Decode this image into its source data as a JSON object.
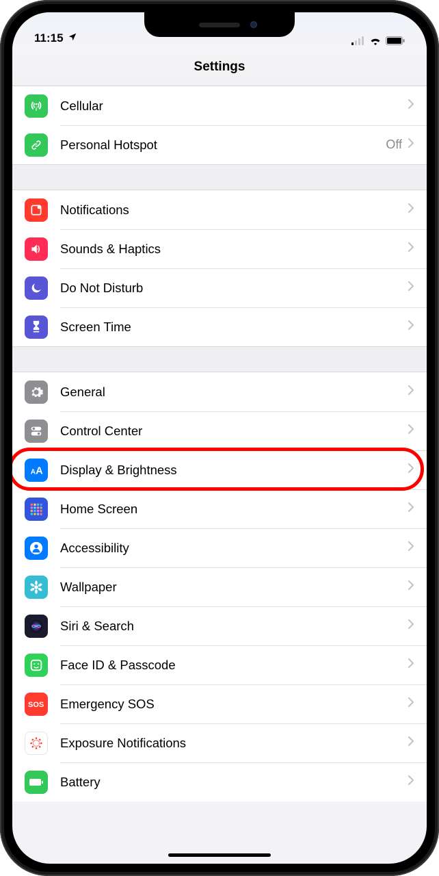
{
  "status": {
    "time": "11:15",
    "location_icon": "location-arrow",
    "signal_bars": 1,
    "wifi": true,
    "battery_full": true
  },
  "header": {
    "title": "Settings"
  },
  "groups": [
    {
      "rows": [
        {
          "id": "cellular",
          "label": "Cellular",
          "icon": "antenna",
          "bg": "#34c759",
          "value": ""
        },
        {
          "id": "hotspot",
          "label": "Personal Hotspot",
          "icon": "link-chain",
          "bg": "#34c759",
          "value": "Off"
        }
      ]
    },
    {
      "rows": [
        {
          "id": "notifications",
          "label": "Notifications",
          "icon": "bell-square",
          "bg": "#ff3b30",
          "value": ""
        },
        {
          "id": "sounds",
          "label": "Sounds & Haptics",
          "icon": "speaker",
          "bg": "#ff2d55",
          "value": ""
        },
        {
          "id": "dnd",
          "label": "Do Not Disturb",
          "icon": "moon",
          "bg": "#5856d6",
          "value": ""
        },
        {
          "id": "screentime",
          "label": "Screen Time",
          "icon": "hourglass",
          "bg": "#5856d6",
          "value": ""
        }
      ]
    },
    {
      "rows": [
        {
          "id": "general",
          "label": "General",
          "icon": "gear",
          "bg": "#8e8e93",
          "value": ""
        },
        {
          "id": "control",
          "label": "Control Center",
          "icon": "toggles",
          "bg": "#8e8e93",
          "value": ""
        },
        {
          "id": "display",
          "label": "Display & Brightness",
          "icon": "text-size",
          "bg": "#007aff",
          "value": "",
          "highlighted": true
        },
        {
          "id": "home",
          "label": "Home Screen",
          "icon": "app-grid",
          "bg": "#3355dd",
          "value": ""
        },
        {
          "id": "accessibility",
          "label": "Accessibility",
          "icon": "person-circle",
          "bg": "#007aff",
          "value": ""
        },
        {
          "id": "wallpaper",
          "label": "Wallpaper",
          "icon": "flower",
          "bg": "#36bdd4",
          "value": ""
        },
        {
          "id": "siri",
          "label": "Siri & Search",
          "icon": "siri",
          "bg": "#1b1b2e",
          "value": ""
        },
        {
          "id": "faceid",
          "label": "Face ID & Passcode",
          "icon": "face",
          "bg": "#30d158",
          "value": ""
        },
        {
          "id": "sos",
          "label": "Emergency SOS",
          "icon": "sos-text",
          "bg": "#ff3b30",
          "value": ""
        },
        {
          "id": "exposure",
          "label": "Exposure Notifications",
          "icon": "virus",
          "bg": "#ffffff",
          "fg": "#ff3b30",
          "value": ""
        },
        {
          "id": "battery",
          "label": "Battery",
          "icon": "battery",
          "bg": "#34c759",
          "value": ""
        }
      ]
    }
  ],
  "annotation": {
    "highlight_row_id": "display",
    "color": "#ff0000"
  }
}
